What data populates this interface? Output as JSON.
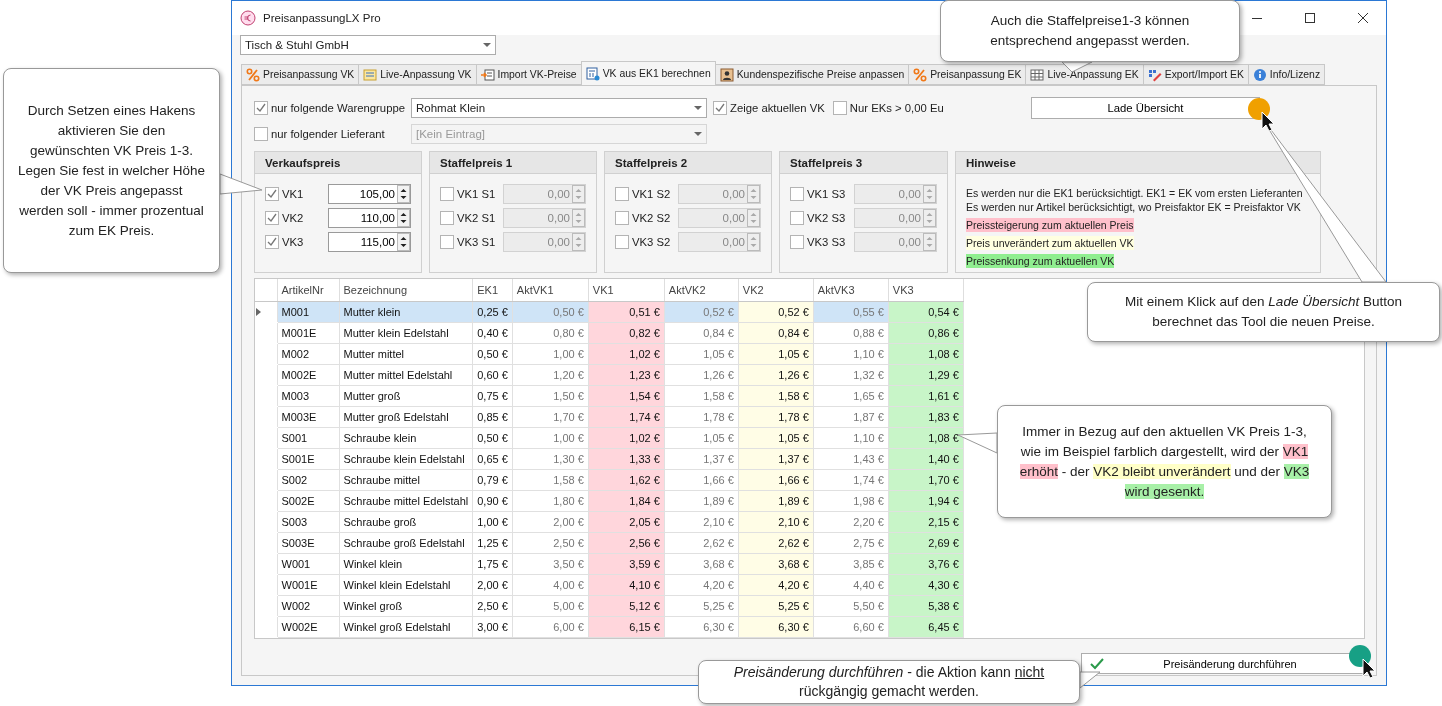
{
  "window": {
    "title": "PreisanpassungLX Pro"
  },
  "company": {
    "value": "Tisch & Stuhl GmbH"
  },
  "tabs": [
    {
      "label": "Preisanpassung VK",
      "selected": false
    },
    {
      "label": "Live-Anpassung VK",
      "selected": false
    },
    {
      "label": "Import VK-Preise",
      "selected": false
    },
    {
      "label": "VK aus EK1 berechnen",
      "selected": true
    },
    {
      "label": "Kundenspezifische Preise anpassen",
      "selected": false
    },
    {
      "label": "Preisanpassung EK",
      "selected": false
    },
    {
      "label": "Live-Anpassung EK",
      "selected": false
    },
    {
      "label": "Export/Import EK",
      "selected": false
    },
    {
      "label": "Info/Lizenz",
      "selected": false
    }
  ],
  "filters": {
    "warengruppe": {
      "label": "nur folgende Warengruppe",
      "checked": true,
      "value": "Rohmat Klein"
    },
    "lieferant": {
      "label": "nur folgender Lieferant",
      "checked": false,
      "value": "[Kein Eintrag]"
    },
    "zeige_vk": {
      "label": "Zeige aktuellen VK",
      "checked": true
    },
    "nur_eks": {
      "label": "Nur EKs > 0,00 Eu",
      "checked": false
    },
    "load_button": "Lade Übersicht"
  },
  "groups": [
    {
      "title": "Verkaufspreis",
      "items": [
        {
          "label": "VK1",
          "checked": true,
          "value": "105,00"
        },
        {
          "label": "VK2",
          "checked": true,
          "value": "110,00"
        },
        {
          "label": "VK3",
          "checked": true,
          "value": "115,00"
        }
      ]
    },
    {
      "title": "Staffelpreis 1",
      "items": [
        {
          "label": "VK1 S1",
          "checked": false,
          "value": "0,00"
        },
        {
          "label": "VK2 S1",
          "checked": false,
          "value": "0,00"
        },
        {
          "label": "VK3 S1",
          "checked": false,
          "value": "0,00"
        }
      ]
    },
    {
      "title": "Staffelpreis 2",
      "items": [
        {
          "label": "VK1 S2",
          "checked": false,
          "value": "0,00"
        },
        {
          "label": "VK2 S2",
          "checked": false,
          "value": "0,00"
        },
        {
          "label": "VK3 S2",
          "checked": false,
          "value": "0,00"
        }
      ]
    },
    {
      "title": "Staffelpreis 3",
      "items": [
        {
          "label": "VK1 S3",
          "checked": false,
          "value": "0,00"
        },
        {
          "label": "VK2 S3",
          "checked": false,
          "value": "0,00"
        },
        {
          "label": "VK3 S3",
          "checked": false,
          "value": "0,00"
        }
      ]
    }
  ],
  "hints": {
    "title": "Hinweise",
    "lines": [
      {
        "text": "Es werden nur die EK1 berücksichtigt. EK1 = EK vom ersten Lieferanten"
      },
      {
        "text": "Es werden nur Artikel berücksichtigt, wo Preisfaktor EK = Preisfaktor VK"
      },
      {
        "text": "Preissteigerung zum aktuellen Preis",
        "color": "#ffc0cb"
      },
      {
        "text": "Preis unverändert zum aktuellen VK",
        "color": "#ffffe0"
      },
      {
        "text": "Preissenkung zum aktuellen VK",
        "color": "#90ee90"
      }
    ]
  },
  "table": {
    "columns": [
      {
        "label": "ArtikelNr",
        "kind": "text"
      },
      {
        "label": "Bezeichnung",
        "kind": "text"
      },
      {
        "label": "EK1",
        "kind": "price"
      },
      {
        "label": "AktVK1",
        "kind": "current"
      },
      {
        "label": "VK1",
        "kind": "new",
        "color": "#ffd6dc"
      },
      {
        "label": "AktVK2",
        "kind": "current"
      },
      {
        "label": "VK2",
        "kind": "new",
        "color": "#fffde6"
      },
      {
        "label": "AktVK3",
        "kind": "current"
      },
      {
        "label": "VK3",
        "kind": "new",
        "color": "#c8f5c8"
      }
    ],
    "rows": [
      {
        "selected": true,
        "cells": [
          "M001",
          "Mutter klein",
          "0,25 €",
          "0,50 €",
          "0,51 €",
          "0,52 €",
          "0,52 €",
          "0,55 €",
          "0,54 €"
        ]
      },
      {
        "selected": false,
        "cells": [
          "M001E",
          "Mutter klein Edelstahl",
          "0,40 €",
          "0,80 €",
          "0,82 €",
          "0,84 €",
          "0,84 €",
          "0,88 €",
          "0,86 €"
        ]
      },
      {
        "selected": false,
        "cells": [
          "M002",
          "Mutter mittel",
          "0,50 €",
          "1,00 €",
          "1,02 €",
          "1,05 €",
          "1,05 €",
          "1,10 €",
          "1,08 €"
        ]
      },
      {
        "selected": false,
        "cells": [
          "M002E",
          "Mutter mittel Edelstahl",
          "0,60 €",
          "1,20 €",
          "1,23 €",
          "1,26 €",
          "1,26 €",
          "1,32 €",
          "1,29 €"
        ]
      },
      {
        "selected": false,
        "cells": [
          "M003",
          "Mutter groß",
          "0,75 €",
          "1,50 €",
          "1,54 €",
          "1,58 €",
          "1,58 €",
          "1,65 €",
          "1,61 €"
        ]
      },
      {
        "selected": false,
        "cells": [
          "M003E",
          "Mutter groß Edelstahl",
          "0,85 €",
          "1,70 €",
          "1,74 €",
          "1,78 €",
          "1,78 €",
          "1,87 €",
          "1,83 €"
        ]
      },
      {
        "selected": false,
        "cells": [
          "S001",
          "Schraube klein",
          "0,50 €",
          "1,00 €",
          "1,02 €",
          "1,05 €",
          "1,05 €",
          "1,10 €",
          "1,08 €"
        ]
      },
      {
        "selected": false,
        "cells": [
          "S001E",
          "Schraube klein Edelstahl",
          "0,65 €",
          "1,30 €",
          "1,33 €",
          "1,37 €",
          "1,37 €",
          "1,43 €",
          "1,40 €"
        ]
      },
      {
        "selected": false,
        "cells": [
          "S002",
          "Schraube mittel",
          "0,79 €",
          "1,58 €",
          "1,62 €",
          "1,66 €",
          "1,66 €",
          "1,74 €",
          "1,70 €"
        ]
      },
      {
        "selected": false,
        "cells": [
          "S002E",
          "Schraube mittel Edelstahl",
          "0,90 €",
          "1,80 €",
          "1,84 €",
          "1,89 €",
          "1,89 €",
          "1,98 €",
          "1,94 €"
        ]
      },
      {
        "selected": false,
        "cells": [
          "S003",
          "Schraube groß",
          "1,00 €",
          "2,00 €",
          "2,05 €",
          "2,10 €",
          "2,10 €",
          "2,20 €",
          "2,15 €"
        ]
      },
      {
        "selected": false,
        "cells": [
          "S003E",
          "Schraube groß Edelstahl",
          "1,25 €",
          "2,50 €",
          "2,56 €",
          "2,62 €",
          "2,62 €",
          "2,75 €",
          "2,69 €"
        ]
      },
      {
        "selected": false,
        "cells": [
          "W001",
          "Winkel klein",
          "1,75 €",
          "3,50 €",
          "3,59 €",
          "3,68 €",
          "3,68 €",
          "3,85 €",
          "3,76 €"
        ]
      },
      {
        "selected": false,
        "cells": [
          "W001E",
          "Winkel klein Edelstahl",
          "2,00 €",
          "4,00 €",
          "4,10 €",
          "4,20 €",
          "4,20 €",
          "4,40 €",
          "4,30 €"
        ]
      },
      {
        "selected": false,
        "cells": [
          "W002",
          "Winkel groß",
          "2,50 €",
          "5,00 €",
          "5,12 €",
          "5,25 €",
          "5,25 €",
          "5,50 €",
          "5,38 €"
        ]
      },
      {
        "selected": false,
        "cells": [
          "W002E",
          "Winkel groß Edelstahl",
          "3,00 €",
          "6,00 €",
          "6,15 €",
          "6,30 €",
          "6,30 €",
          "6,60 €",
          "6,45 €"
        ]
      }
    ]
  },
  "apply_button": "Preisänderung durchführen",
  "callouts": [
    {
      "kind": "left",
      "segments": [
        {
          "text": "Durch Setzen eines Hakens aktivieren Sie den gewünschten VK Preis 1-3. Legen Sie fest in welcher Höhe der VK Preis angepasst werden soll - immer prozentual zum EK Preis."
        }
      ]
    },
    {
      "kind": "top",
      "segments": [
        {
          "text": "Auch die Staffelpreise1-3 können entsprechend angepasst werden."
        }
      ]
    },
    {
      "kind": "right",
      "segments": [
        {
          "text": "Mit einem Klick auf den "
        },
        {
          "text": "Lade Übersicht",
          "italic": true
        },
        {
          "text": " Button berechnet das Tool die neuen Preise."
        }
      ]
    },
    {
      "kind": "middle",
      "segments": [
        {
          "text": "Immer in Bezug auf den aktuellen VK Preis 1-3, wie im Beispiel farblich dargestellt, wird der "
        },
        {
          "text": "VK1 erhöht",
          "color": "#ffc0cb"
        },
        {
          "text": " - der "
        },
        {
          "text": "VK2 bleibt unverändert",
          "color": "#ffffc8"
        },
        {
          "text": " und der "
        },
        {
          "text": "VK3 wird gesenkt.",
          "color": "#a8f0a8"
        }
      ]
    },
    {
      "kind": "bottom",
      "segments": [
        {
          "text": "Preisänderung durchführen",
          "italic": true
        },
        {
          "text": " - die Aktion kann "
        },
        {
          "text": "nicht",
          "underline": true
        },
        {
          "text": " rückgängig gemacht werden."
        }
      ]
    }
  ]
}
